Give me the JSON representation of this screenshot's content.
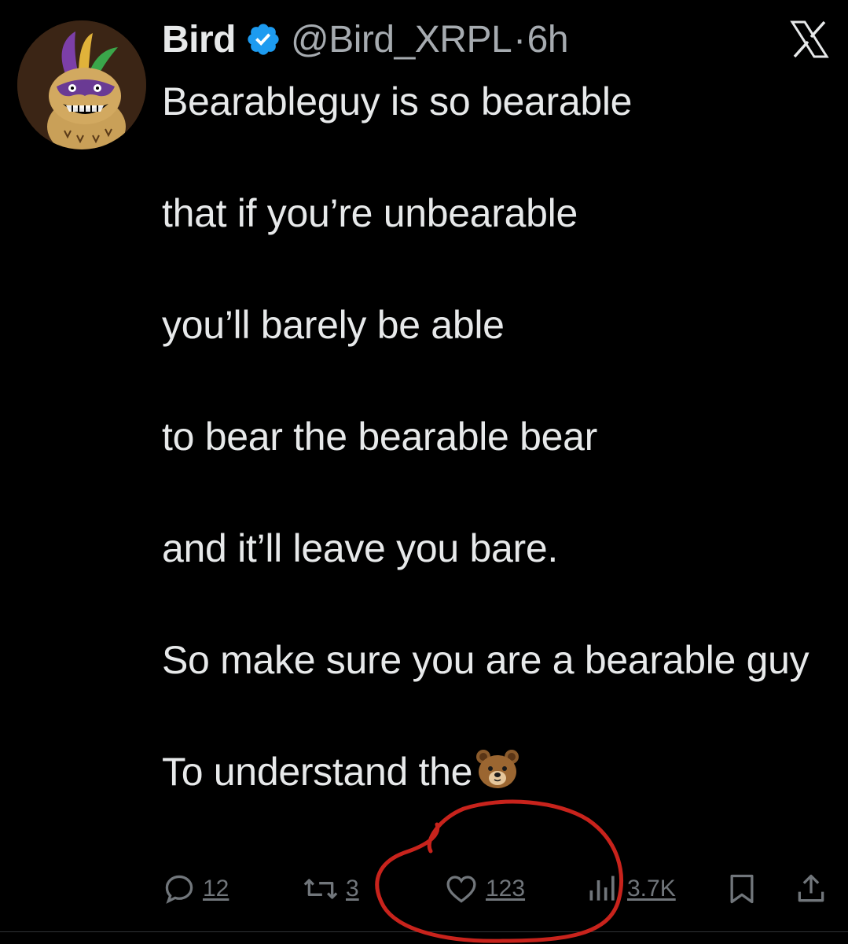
{
  "author": {
    "display_name": "Bird",
    "handle": "@Bird_XRPL",
    "separator": "·",
    "time_ago": "6h",
    "verified_color": "#1d9bf0",
    "avatar_icon": "bear-with-mask-avatar"
  },
  "brand": {
    "logo_icon": "x-logo-icon"
  },
  "tweet": {
    "lines": [
      "Bearableguy is so bearable",
      "that if you’re unbearable",
      "you’ll barely be able",
      "to bear the bearable bear",
      "and it’ll leave you bare.",
      "So make sure you are a bearable guy",
      "To understand the"
    ],
    "trailing_emoji": "bear-face-emoji"
  },
  "actions": {
    "replies": "12",
    "reposts": "3",
    "likes": "123",
    "views": "3.7K"
  },
  "annotation": {
    "color": "#c8231c",
    "shape": "hand-drawn-circle-around-like-button"
  }
}
